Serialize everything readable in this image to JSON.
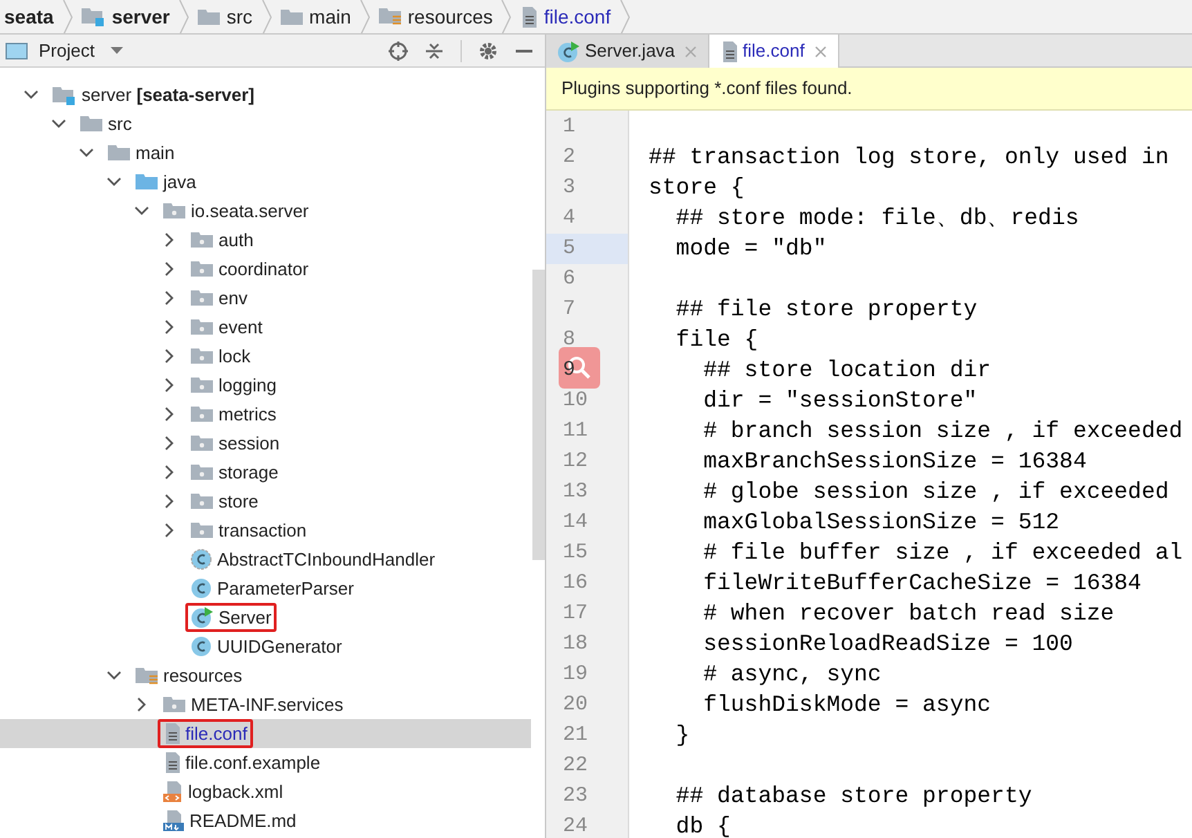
{
  "breadcrumbs": [
    {
      "label": "seata",
      "bold": true,
      "kind": "none"
    },
    {
      "label": "server",
      "bold": true,
      "kind": "module"
    },
    {
      "label": "src",
      "bold": false,
      "kind": "folder"
    },
    {
      "label": "main",
      "bold": false,
      "kind": "folder"
    },
    {
      "label": "resources",
      "bold": false,
      "kind": "resources"
    },
    {
      "label": "file.conf",
      "bold": false,
      "kind": "conf"
    }
  ],
  "project_panel": {
    "title": "Project",
    "tree": [
      {
        "label": "server",
        "suffix": "[seata-server]",
        "kind": "module",
        "expanded": true,
        "selected": false,
        "highlighted": false,
        "children": [
          {
            "label": "src",
            "kind": "folder",
            "expanded": true,
            "selected": false,
            "highlighted": false,
            "children": [
              {
                "label": "main",
                "kind": "folder",
                "expanded": true,
                "selected": false,
                "highlighted": false,
                "children": [
                  {
                    "label": "java",
                    "kind": "source",
                    "expanded": true,
                    "selected": false,
                    "highlighted": false,
                    "children": [
                      {
                        "label": "io.seata.server",
                        "kind": "package",
                        "expanded": true,
                        "selected": false,
                        "highlighted": false,
                        "children": [
                          {
                            "label": "auth",
                            "kind": "package",
                            "expanded": false,
                            "selected": false,
                            "highlighted": false
                          },
                          {
                            "label": "coordinator",
                            "kind": "package",
                            "expanded": false,
                            "selected": false,
                            "highlighted": false
                          },
                          {
                            "label": "env",
                            "kind": "package",
                            "expanded": false,
                            "selected": false,
                            "highlighted": false
                          },
                          {
                            "label": "event",
                            "kind": "package",
                            "expanded": false,
                            "selected": false,
                            "highlighted": false
                          },
                          {
                            "label": "lock",
                            "kind": "package",
                            "expanded": false,
                            "selected": false,
                            "highlighted": false
                          },
                          {
                            "label": "logging",
                            "kind": "package",
                            "expanded": false,
                            "selected": false,
                            "highlighted": false
                          },
                          {
                            "label": "metrics",
                            "kind": "package",
                            "expanded": false,
                            "selected": false,
                            "highlighted": false
                          },
                          {
                            "label": "session",
                            "kind": "package",
                            "expanded": false,
                            "selected": false,
                            "highlighted": false
                          },
                          {
                            "label": "storage",
                            "kind": "package",
                            "expanded": false,
                            "selected": false,
                            "highlighted": false
                          },
                          {
                            "label": "store",
                            "kind": "package",
                            "expanded": false,
                            "selected": false,
                            "highlighted": false
                          },
                          {
                            "label": "transaction",
                            "kind": "package",
                            "expanded": false,
                            "selected": false,
                            "highlighted": false
                          },
                          {
                            "label": "AbstractTCInboundHandler",
                            "kind": "abstract-class",
                            "selected": false,
                            "highlighted": false
                          },
                          {
                            "label": "ParameterParser",
                            "kind": "class",
                            "selected": false,
                            "highlighted": false
                          },
                          {
                            "label": "Server",
                            "kind": "run-class",
                            "selected": false,
                            "highlighted": true
                          },
                          {
                            "label": "UUIDGenerator",
                            "kind": "class",
                            "selected": false,
                            "highlighted": false
                          }
                        ]
                      }
                    ]
                  },
                  {
                    "label": "resources",
                    "kind": "resources",
                    "expanded": true,
                    "selected": false,
                    "highlighted": false,
                    "children": [
                      {
                        "label": "META-INF.services",
                        "kind": "package",
                        "expanded": false,
                        "selected": false,
                        "highlighted": false
                      },
                      {
                        "label": "file.conf",
                        "kind": "conf",
                        "selected": true,
                        "highlighted": true
                      },
                      {
                        "label": "file.conf.example",
                        "kind": "conf",
                        "selected": false,
                        "highlighted": false
                      },
                      {
                        "label": "logback.xml",
                        "kind": "xml",
                        "selected": false,
                        "highlighted": false
                      },
                      {
                        "label": "README.md",
                        "kind": "md",
                        "selected": false,
                        "highlighted": false
                      }
                    ]
                  }
                ]
              }
            ]
          }
        ]
      }
    ]
  },
  "editor": {
    "tabs": [
      {
        "label": "Server.java",
        "kind": "run-class",
        "selected": false
      },
      {
        "label": "file.conf",
        "kind": "conf",
        "selected": true
      }
    ],
    "notice": "Plugins supporting *.conf files found.",
    "lines": [
      {
        "number": "1",
        "current": false
      },
      {
        "number": "2",
        "current": false,
        "text": "## transaction log store, only used in"
      },
      {
        "number": "3",
        "current": false,
        "text": "store {"
      },
      {
        "number": "4",
        "current": false,
        "text": "  ## store mode: file、db、redis"
      },
      {
        "number": "5",
        "current": true,
        "text": "  mode = \"db\""
      },
      {
        "number": "6",
        "current": false
      },
      {
        "number": "7",
        "current": false,
        "text": "  ## file store property"
      },
      {
        "number": "8",
        "current": false,
        "text": "  file {"
      },
      {
        "number": "9",
        "current": false,
        "text": "    ## store location dir"
      },
      {
        "number": "10",
        "current": false,
        "text": "    dir = \"sessionStore\""
      },
      {
        "number": "11",
        "current": false,
        "text": "    # branch session size , if exceeded"
      },
      {
        "number": "12",
        "current": false,
        "text": "    maxBranchSessionSize = 16384"
      },
      {
        "number": "13",
        "current": false,
        "text": "    # globe session size , if exceeded"
      },
      {
        "number": "14",
        "current": false,
        "text": "    maxGlobalSessionSize = 512"
      },
      {
        "number": "15",
        "current": false,
        "text": "    # file buffer size , if exceeded al"
      },
      {
        "number": "16",
        "current": false,
        "text": "    fileWriteBufferCacheSize = 16384"
      },
      {
        "number": "17",
        "current": false,
        "text": "    # when recover batch read size"
      },
      {
        "number": "18",
        "current": false,
        "text": "    sessionReloadReadSize = 100"
      },
      {
        "number": "19",
        "current": false,
        "text": "    # async, sync"
      },
      {
        "number": "20",
        "current": false,
        "text": "    flushDiskMode = async"
      },
      {
        "number": "21",
        "current": false,
        "text": "  }"
      },
      {
        "number": "22",
        "current": false
      },
      {
        "number": "23",
        "current": false,
        "text": "  ## database store property"
      },
      {
        "number": "24",
        "current": false,
        "text": "  db {"
      }
    ]
  }
}
